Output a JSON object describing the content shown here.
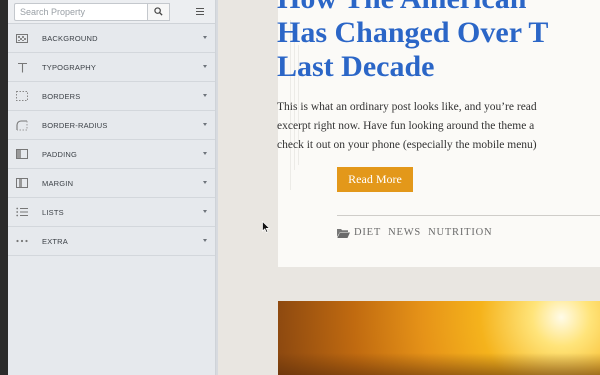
{
  "editor": {
    "search_placeholder": "Search Property",
    "groups": [
      {
        "label": "BACKGROUND",
        "icon": "background-icon"
      },
      {
        "label": "TYPOGRAPHY",
        "icon": "typography-icon"
      },
      {
        "label": "BORDERS",
        "icon": "borders-icon"
      },
      {
        "label": "BORDER-RADIUS",
        "icon": "border-radius-icon"
      },
      {
        "label": "PADDING",
        "icon": "padding-icon"
      },
      {
        "label": "MARGIN",
        "icon": "margin-icon"
      },
      {
        "label": "LISTS",
        "icon": "lists-icon"
      },
      {
        "label": "EXTRA",
        "icon": "extra-icon"
      }
    ]
  },
  "post": {
    "title_lines": [
      "How The American",
      "Has Changed Over T",
      "Last Decade"
    ],
    "excerpt_lines": [
      "This is what an ordinary post looks like, and you’re read",
      "excerpt right now. Have fun looking around the theme a",
      "check it out on your phone (especially the mobile menu)"
    ],
    "read_more": "Read More",
    "tags": [
      "DIET",
      "NEWS",
      "NUTRITION"
    ]
  },
  "colors": {
    "title": "#2b66c7",
    "button": "#e3981a",
    "panel_bg": "#e6e9ed"
  }
}
